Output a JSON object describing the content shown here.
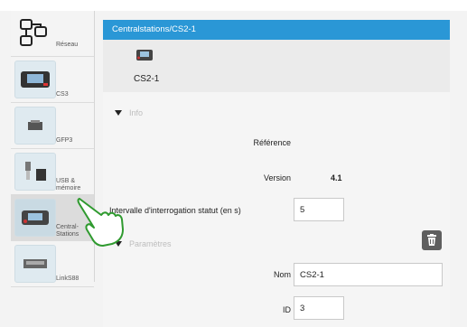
{
  "sidebar": {
    "items": [
      {
        "label": "Réseau",
        "icon": "network-icon"
      },
      {
        "label": "CS3",
        "icon": "cs3-device-icon"
      },
      {
        "label": "GFP3",
        "icon": "gfp3-device-icon"
      },
      {
        "label": "USB & mémoire",
        "icon": "usb-memory-icon"
      },
      {
        "label": "Central-Stations",
        "icon": "central-station-icon"
      },
      {
        "label": "LinkS88",
        "icon": "links88-device-icon"
      }
    ],
    "active_index": 4
  },
  "header": {
    "breadcrumb": "Centralstations/CS2-1"
  },
  "device": {
    "name": "CS2-1"
  },
  "info_section": {
    "title": "Info",
    "reference_label": "Référence",
    "version_label": "Version",
    "version_value": "4.1",
    "interval_label": "Intervalle d'interrogation statut (en s)",
    "interval_value": "5"
  },
  "params_section": {
    "title": "Paramètres",
    "name_label": "Nom",
    "name_value": "CS2-1",
    "id_label": "ID",
    "id_value": "3"
  }
}
